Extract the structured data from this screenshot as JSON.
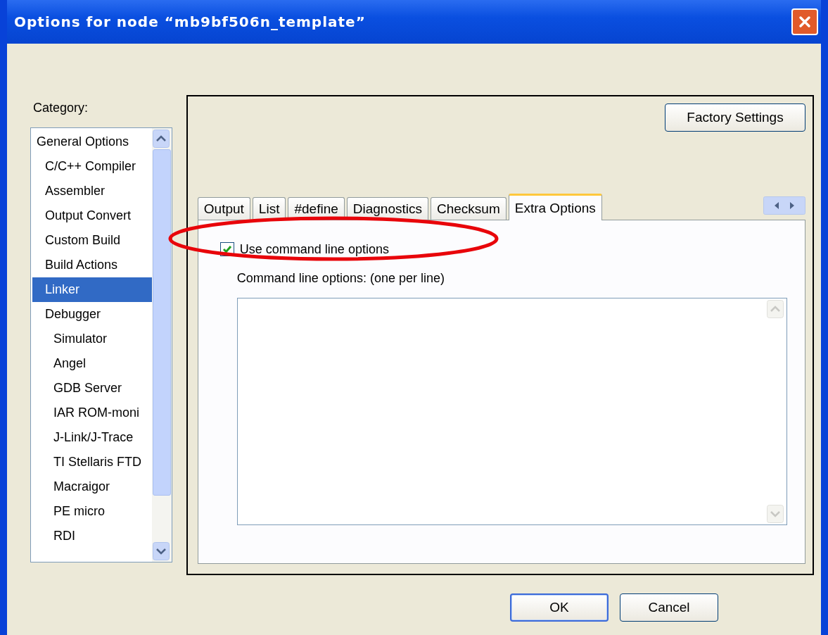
{
  "window": {
    "title": "Options for node “mb9bf506n_template”"
  },
  "category": {
    "label": "Category:",
    "items": [
      {
        "label": "General Options",
        "selected": false
      },
      {
        "label": "C/C++ Compiler",
        "selected": false
      },
      {
        "label": "Assembler",
        "selected": false
      },
      {
        "label": "Output Convert",
        "selected": false
      },
      {
        "label": "Custom Build",
        "selected": false
      },
      {
        "label": "Build Actions",
        "selected": false
      },
      {
        "label": "Linker",
        "selected": true
      },
      {
        "label": "Debugger",
        "selected": false,
        "children": [
          {
            "label": "Simulator",
            "selected": false
          },
          {
            "label": "Angel",
            "selected": false
          },
          {
            "label": "GDB Server",
            "selected": false
          },
          {
            "label": "IAR ROM-moni",
            "selected": false
          },
          {
            "label": "J-Link/J-Trace",
            "selected": false
          },
          {
            "label": "TI Stellaris FTD",
            "selected": false
          },
          {
            "label": "Macraigor",
            "selected": false
          },
          {
            "label": "PE micro",
            "selected": false
          },
          {
            "label": "RDI",
            "selected": false
          }
        ]
      }
    ]
  },
  "factory_button": "Factory Settings",
  "tabs": [
    {
      "label": "Output",
      "selected": false
    },
    {
      "label": "List",
      "selected": false
    },
    {
      "label": "#define",
      "selected": false
    },
    {
      "label": "Diagnostics",
      "selected": false
    },
    {
      "label": "Checksum",
      "selected": false
    },
    {
      "label": "Extra Options",
      "selected": true
    }
  ],
  "use_command_line": {
    "label": "Use command line options",
    "checked": true
  },
  "command_line": {
    "label": "Command line options:  (one per line)"
  },
  "buttons": [
    "OK",
    "Cancel"
  ]
}
